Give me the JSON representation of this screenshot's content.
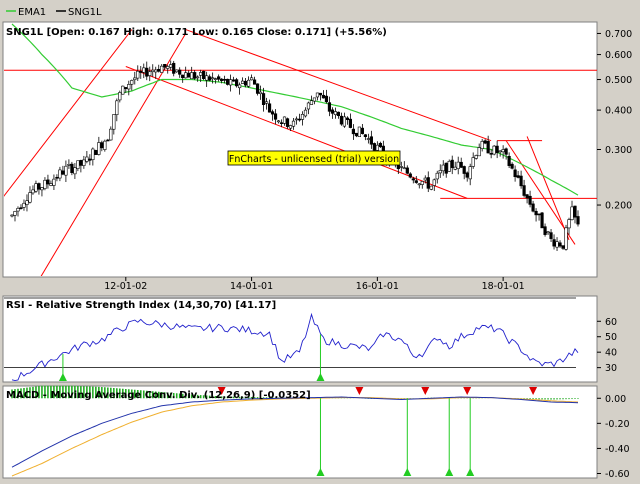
{
  "legend": {
    "items": [
      {
        "name": "EMA1",
        "color": "#33cc33"
      },
      {
        "name": "SNG1L",
        "color": "#000000"
      }
    ]
  },
  "price_panel": {
    "header": "SNG1L [Open: 0.167  High: 0.171  Low: 0.165  Close: 0.171] (+5.56%)"
  },
  "rsi_panel": {
    "header": "RSI - Relative Strength Index (14,30,70) [41.17]"
  },
  "macd_panel": {
    "header": "MACD - Moving Average Conv. Div. (12,26,9) [-0.0352]"
  },
  "watermark": "FnCharts - unlicensed (trial) version",
  "colors": {
    "up_candle": "#ffffff",
    "down_candle": "#000000",
    "ema": "#33cc33",
    "trendline": "#ff0000",
    "rsi_line": "#2222cc",
    "macd_line": "#2233aa",
    "signal_line": "#f0b030",
    "histogram": "#22aa22",
    "buy_marker": "#22cc22",
    "sell_marker": "#dd0000",
    "watermark_bg": "#ffff00"
  },
  "chart_data": [
    {
      "type": "candlestick",
      "yscale": "log",
      "ylim": [
        0.12,
        0.75
      ],
      "yticks": [
        0.2,
        0.3,
        0.4,
        0.5,
        0.6,
        0.7
      ],
      "ytick_labels": [
        "0.200",
        "0.300",
        "0.400",
        "0.500",
        "0.600",
        "0.700"
      ],
      "xticks": [
        {
          "index": 38,
          "label": "12-01-02"
        },
        {
          "index": 80,
          "label": "14-01-01"
        },
        {
          "index": 122,
          "label": "16-01-01"
        },
        {
          "index": 164,
          "label": "18-01-01"
        }
      ],
      "bar_count": 190,
      "horizontal_levels": [
        0.535,
        0.21
      ],
      "price_path": [
        [
          0,
          0.185
        ],
        [
          6,
          0.22
        ],
        [
          12,
          0.235
        ],
        [
          18,
          0.26
        ],
        [
          24,
          0.27
        ],
        [
          28,
          0.3
        ],
        [
          32,
          0.33
        ],
        [
          36,
          0.45
        ],
        [
          40,
          0.5
        ],
        [
          45,
          0.53
        ],
        [
          50,
          0.55
        ],
        [
          56,
          0.53
        ],
        [
          62,
          0.51
        ],
        [
          68,
          0.5
        ],
        [
          74,
          0.48
        ],
        [
          80,
          0.5
        ],
        [
          86,
          0.4
        ],
        [
          90,
          0.37
        ],
        [
          94,
          0.36
        ],
        [
          98,
          0.4
        ],
        [
          102,
          0.46
        ],
        [
          106,
          0.4
        ],
        [
          112,
          0.36
        ],
        [
          118,
          0.33
        ],
        [
          124,
          0.29
        ],
        [
          130,
          0.26
        ],
        [
          136,
          0.24
        ],
        [
          140,
          0.23
        ],
        [
          144,
          0.26
        ],
        [
          148,
          0.27
        ],
        [
          152,
          0.255
        ],
        [
          156,
          0.31
        ],
        [
          160,
          0.3
        ],
        [
          164,
          0.29
        ],
        [
          168,
          0.25
        ],
        [
          172,
          0.21
        ],
        [
          176,
          0.18
        ],
        [
          180,
          0.155
        ],
        [
          184,
          0.15
        ],
        [
          187,
          0.19
        ],
        [
          189,
          0.171
        ]
      ],
      "ema_path": [
        [
          0,
          0.75
        ],
        [
          10,
          0.6
        ],
        [
          20,
          0.47
        ],
        [
          30,
          0.44
        ],
        [
          40,
          0.46
        ],
        [
          50,
          0.5
        ],
        [
          60,
          0.5
        ],
        [
          70,
          0.49
        ],
        [
          80,
          0.47
        ],
        [
          90,
          0.45
        ],
        [
          100,
          0.43
        ],
        [
          110,
          0.41
        ],
        [
          120,
          0.38
        ],
        [
          130,
          0.35
        ],
        [
          140,
          0.33
        ],
        [
          150,
          0.31
        ],
        [
          160,
          0.3
        ],
        [
          170,
          0.27
        ],
        [
          180,
          0.24
        ],
        [
          189,
          0.215
        ]
      ],
      "trendlines": [
        [
          [
            -5,
            0.2
          ],
          [
            40,
            0.72
          ]
        ],
        [
          [
            5,
            0.1
          ],
          [
            58,
            0.7
          ]
        ],
        [
          [
            38,
            0.55
          ],
          [
            152,
            0.21
          ]
        ],
        [
          [
            58,
            0.72
          ],
          [
            160,
            0.32
          ]
        ],
        [
          [
            165,
            0.32
          ],
          [
            188,
            0.15
          ]
        ],
        [
          [
            172,
            0.33
          ],
          [
            186,
            0.155
          ]
        ],
        [
          [
            162,
            0.32
          ],
          [
            177,
            0.32
          ]
        ]
      ]
    },
    {
      "type": "line",
      "name": "RSI",
      "ylim": [
        22,
        66
      ],
      "yticks": [
        30,
        40,
        50,
        60
      ],
      "levels": [
        30,
        70
      ],
      "values": [
        [
          0,
          22
        ],
        [
          8,
          30
        ],
        [
          16,
          38
        ],
        [
          24,
          45
        ],
        [
          30,
          48
        ],
        [
          36,
          55
        ],
        [
          42,
          60
        ],
        [
          50,
          58
        ],
        [
          60,
          55
        ],
        [
          70,
          56
        ],
        [
          80,
          54
        ],
        [
          86,
          52
        ],
        [
          90,
          34
        ],
        [
          96,
          40
        ],
        [
          100,
          62
        ],
        [
          104,
          48
        ],
        [
          110,
          45
        ],
        [
          120,
          42
        ],
        [
          124,
          52
        ],
        [
          130,
          48
        ],
        [
          134,
          38
        ],
        [
          138,
          40
        ],
        [
          142,
          50
        ],
        [
          146,
          44
        ],
        [
          150,
          50
        ],
        [
          156,
          56
        ],
        [
          162,
          55
        ],
        [
          166,
          48
        ],
        [
          170,
          42
        ],
        [
          174,
          34
        ],
        [
          178,
          32
        ],
        [
          182,
          33
        ],
        [
          186,
          38
        ],
        [
          189,
          41.17
        ]
      ]
    },
    {
      "type": "line",
      "name": "MACD",
      "ylim": [
        -0.62,
        0.05
      ],
      "yticks": [
        0.0,
        -0.2,
        -0.4,
        -0.6
      ],
      "ytick_labels": [
        "0.00",
        "-0.20",
        "-0.40",
        "-0.60"
      ],
      "macd": [
        [
          0,
          -0.55
        ],
        [
          10,
          -0.42
        ],
        [
          20,
          -0.3
        ],
        [
          30,
          -0.2
        ],
        [
          40,
          -0.12
        ],
        [
          50,
          -0.06
        ],
        [
          60,
          -0.03
        ],
        [
          70,
          -0.015
        ],
        [
          80,
          -0.005
        ],
        [
          90,
          0.0
        ],
        [
          100,
          0.005
        ],
        [
          110,
          0.01
        ],
        [
          120,
          0.0
        ],
        [
          130,
          -0.01
        ],
        [
          140,
          0.0
        ],
        [
          150,
          0.01
        ],
        [
          160,
          0.005
        ],
        [
          170,
          -0.01
        ],
        [
          180,
          -0.03
        ],
        [
          189,
          -0.035
        ]
      ],
      "signal": [
        [
          0,
          -0.62
        ],
        [
          10,
          -0.52
        ],
        [
          20,
          -0.4
        ],
        [
          30,
          -0.29
        ],
        [
          40,
          -0.19
        ],
        [
          50,
          -0.11
        ],
        [
          60,
          -0.06
        ],
        [
          70,
          -0.03
        ],
        [
          80,
          -0.015
        ],
        [
          90,
          -0.005
        ],
        [
          100,
          0.0
        ],
        [
          110,
          0.005
        ],
        [
          120,
          0.005
        ],
        [
          130,
          -0.005
        ],
        [
          140,
          -0.005
        ],
        [
          150,
          0.005
        ],
        [
          160,
          0.005
        ],
        [
          170,
          -0.005
        ],
        [
          180,
          -0.02
        ],
        [
          189,
          -0.03
        ]
      ]
    }
  ],
  "signals": {
    "rsi_buy": [
      17,
      103
    ],
    "macd_buy": [
      103,
      132,
      146,
      153
    ],
    "macd_sell": [
      70,
      116,
      138,
      152,
      174
    ]
  }
}
